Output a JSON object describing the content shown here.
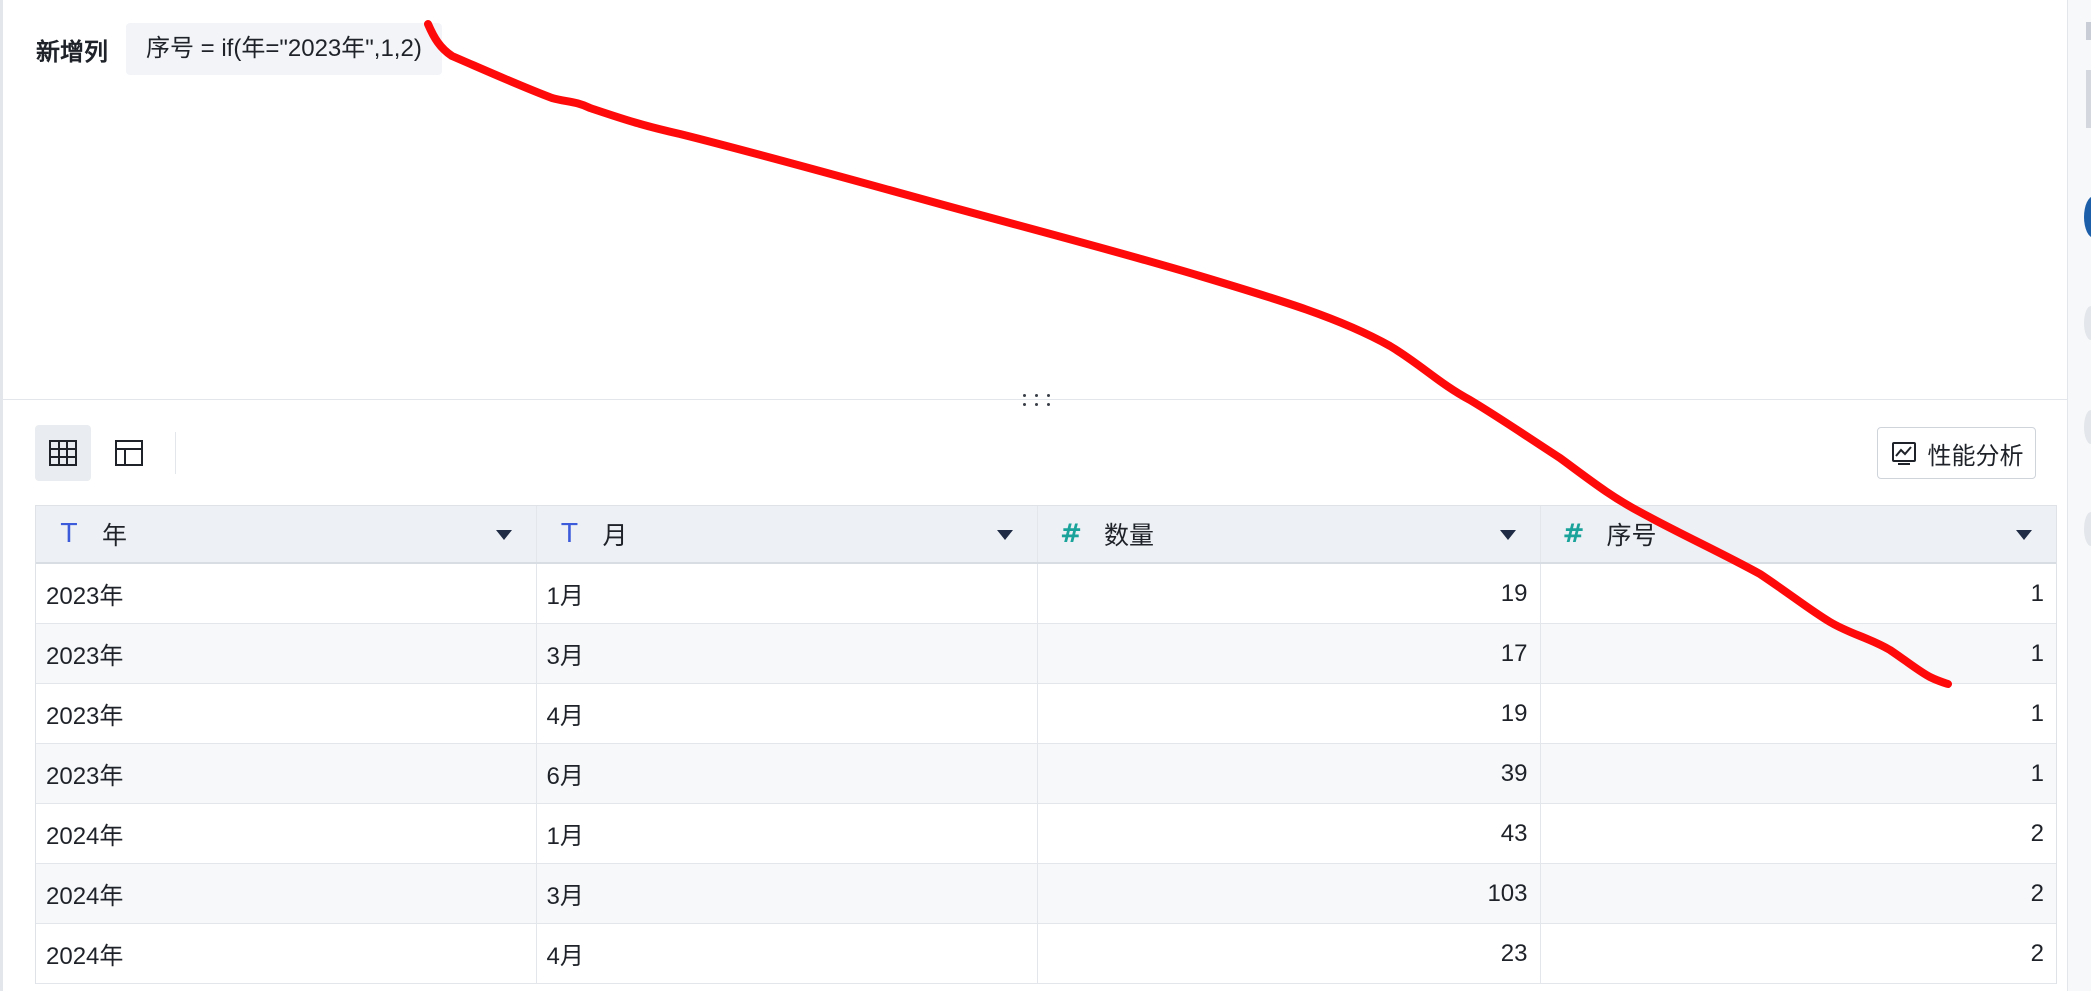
{
  "formula_panel": {
    "title": "新增列",
    "formula": "序号 = if(年=\"2023年\",1,2)"
  },
  "toolbar": {
    "grid_view_icon": "table-grid-icon",
    "layout_view_icon": "layout-panel-icon",
    "perf_label": "性能分析",
    "perf_icon": "chart-monitor-icon"
  },
  "table": {
    "columns": [
      {
        "label": "年",
        "type_icon": "T",
        "type": "text"
      },
      {
        "label": "月",
        "type_icon": "T",
        "type": "text"
      },
      {
        "label": "数量",
        "type_icon": "#",
        "type": "number"
      },
      {
        "label": "序号",
        "type_icon": "#",
        "type": "number"
      }
    ],
    "rows": [
      [
        "2023年",
        "1月",
        "19",
        "1"
      ],
      [
        "2023年",
        "3月",
        "17",
        "1"
      ],
      [
        "2023年",
        "4月",
        "19",
        "1"
      ],
      [
        "2023年",
        "6月",
        "39",
        "1"
      ],
      [
        "2024年",
        "1月",
        "43",
        "2"
      ],
      [
        "2024年",
        "3月",
        "103",
        "2"
      ],
      [
        "2024年",
        "4月",
        "23",
        "2"
      ]
    ]
  },
  "colors": {
    "annotation_stroke": "#ff0a0a",
    "text_type_icon": "#3b5bdb",
    "number_type_icon": "#1aa39a"
  }
}
